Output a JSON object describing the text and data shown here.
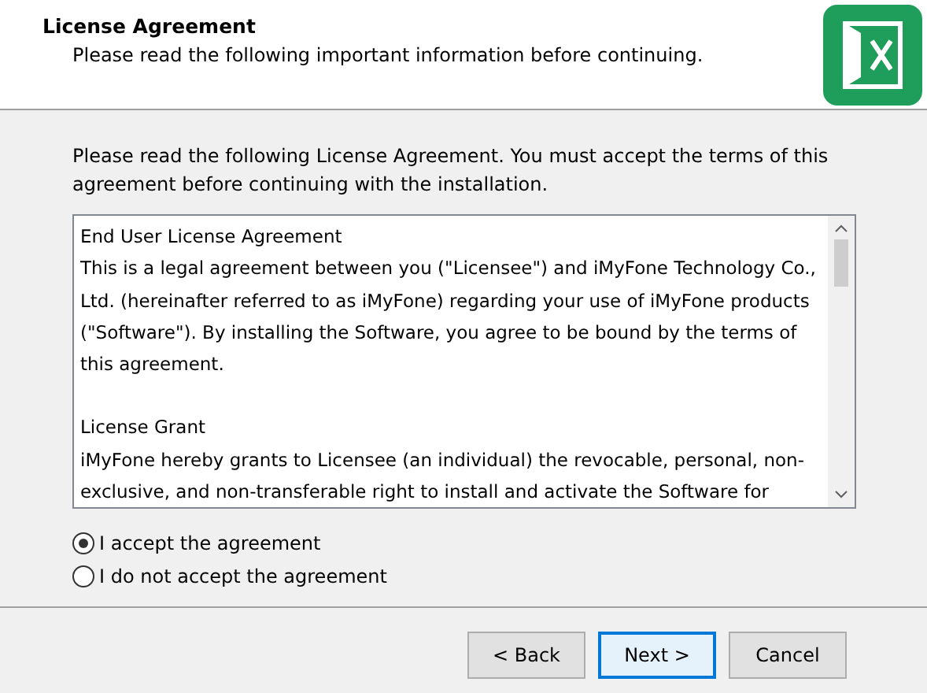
{
  "header": {
    "title": "License Agreement",
    "subtitle": "Please read the following important information before continuing."
  },
  "intro": "Please read the following License Agreement. You must accept the terms of this agreement before continuing with the installation.",
  "license_text": [
    {
      "lines": [
        "End User License Agreement",
        "This is a legal agreement between you (\"Licensee\") and iMyFone Technology Co., Ltd. (hereinafter referred to as iMyFone) regarding your use of iMyFone products (\"Software\"). By installing the Software, you agree to be bound by the terms of this agreement."
      ]
    },
    {
      "lines": [
        "License Grant",
        "iMyFone hereby grants to Licensee (an individual) the revocable, personal, non-exclusive, and non-transferable right to install and activate the Software for"
      ]
    }
  ],
  "options": [
    {
      "label": "I accept the agreement",
      "selected": true
    },
    {
      "label": "I do not accept the agreement",
      "selected": false
    }
  ],
  "buttons": [
    {
      "label": "< Back",
      "default": false
    },
    {
      "label": "Next >",
      "default": true
    },
    {
      "label": "Cancel",
      "default": false
    }
  ]
}
